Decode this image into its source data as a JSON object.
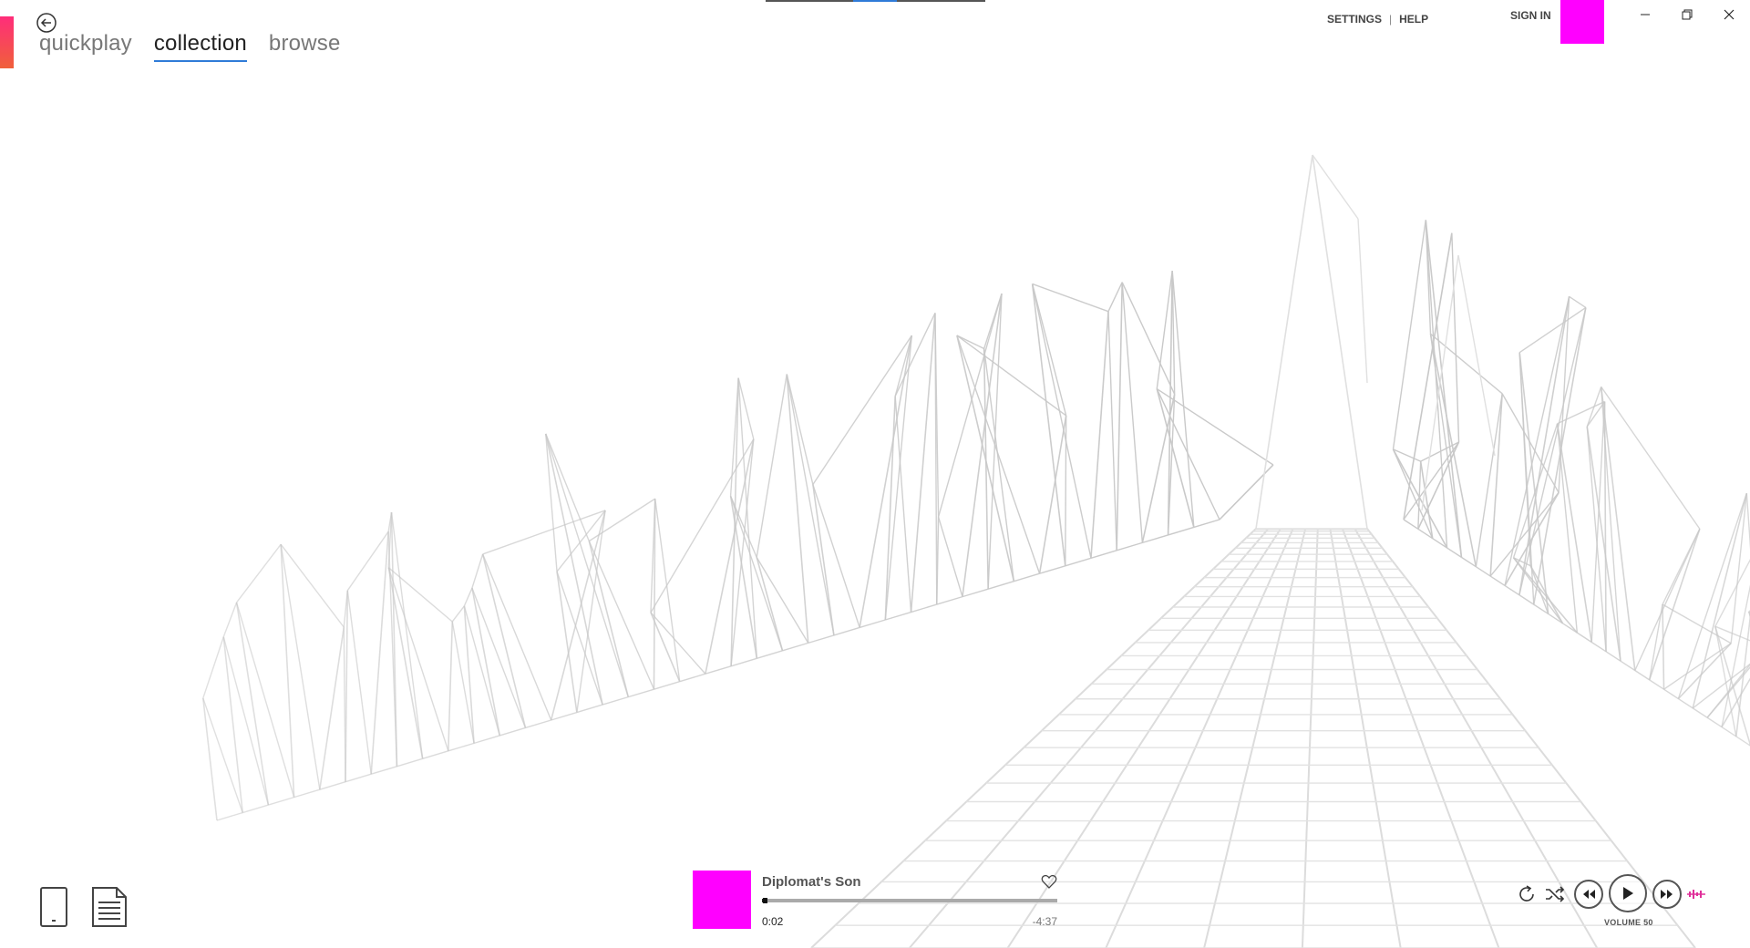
{
  "nav": {
    "tabs": [
      {
        "label": "quickplay",
        "active": false
      },
      {
        "label": "collection",
        "active": true
      },
      {
        "label": "browse",
        "active": false
      }
    ]
  },
  "header": {
    "settings_label": "SETTINGS",
    "separator": "|",
    "help_label": "HELP",
    "signin_label": "SIGN IN"
  },
  "player": {
    "track_title": "Diplomat's Son",
    "elapsed": "0:02",
    "remaining": "-4:37",
    "progress_fraction": 0.007,
    "volume_label": "VOLUME 50"
  },
  "colors": {
    "accent": "#2f7bd8",
    "album_placeholder": "#ff00ff",
    "avatar_placeholder": "#ff00ff",
    "equalizer_icon": "#e0309a"
  },
  "icons": [
    "back-arrow-icon",
    "minimize-icon",
    "restore-icon",
    "close-icon",
    "phone-icon",
    "document-icon",
    "heart-icon",
    "repeat-icon",
    "shuffle-icon",
    "rewind-icon",
    "play-icon",
    "fast-forward-icon",
    "equalizer-icon"
  ]
}
